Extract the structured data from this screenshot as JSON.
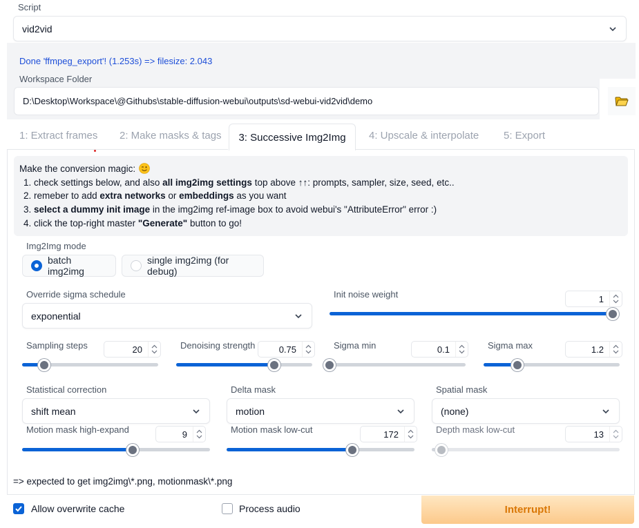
{
  "script": {
    "label": "Script",
    "value": "vid2vid"
  },
  "status_message": "Done 'ffmpeg_export'! (1.253s) => filesize: 2.043",
  "workspace": {
    "label": "Workspace Folder",
    "value": "D:\\Desktop\\Workspace\\@Githubs\\stable-diffusion-webui\\outputs\\sd-webui-vid2vid\\demo"
  },
  "tabs": [
    {
      "label": "1: Extract frames",
      "active": false
    },
    {
      "label": "2: Make masks & tags",
      "active": false
    },
    {
      "label": "3: Successive Img2Img",
      "active": true
    },
    {
      "label": "4: Upscale & interpolate",
      "active": false
    },
    {
      "label": "5: Export",
      "active": false
    }
  ],
  "instructions": {
    "intro": "Make the conversion magic:",
    "step1": {
      "num": "1.",
      "a": "check settings below, and also ",
      "b": "all img2img settings",
      "c": " top above ↑↑: prompts, sampler, size, seed, etc.."
    },
    "step2": {
      "num": "2.",
      "a": "remeber to add ",
      "b": "extra networks",
      "c": " or ",
      "d": "embeddings",
      "e": " as you want"
    },
    "step3": {
      "num": "3.",
      "b": "select a dummy init image",
      "c": " in the img2img ref-image box to avoid webui's \"AttributeError\" error :)"
    },
    "step4": {
      "num": "4.",
      "a": "click the top-right master ",
      "b": "\"Generate\"",
      "c": " button to go!"
    }
  },
  "img2img_mode": {
    "label": "Img2Img mode",
    "options": [
      {
        "label": "batch img2img",
        "selected": true
      },
      {
        "label": "single img2img (for debug)",
        "selected": false
      }
    ]
  },
  "override_sigma": {
    "label": "Override sigma schedule",
    "value": "exponential"
  },
  "init_noise_weight": {
    "label": "Init noise weight",
    "value": "1",
    "fraction": 1.0
  },
  "sampling_steps": {
    "label": "Sampling steps",
    "value": "20",
    "fraction": 0.16
  },
  "denoising_strength": {
    "label": "Denoising strength",
    "value": "0.75",
    "fraction": 0.72
  },
  "sigma_min": {
    "label": "Sigma min",
    "value": "0.1",
    "fraction": 0.0
  },
  "sigma_max": {
    "label": "Sigma max",
    "value": "1.2",
    "fraction": 0.25
  },
  "statistical_correction": {
    "label": "Statistical correction",
    "value": "shift mean"
  },
  "delta_mask": {
    "label": "Delta mask",
    "value": "motion"
  },
  "spatial_mask": {
    "label": "Spatial mask",
    "value": "(none)"
  },
  "motion_highexpand": {
    "label": "Motion mask high-expand",
    "value": "9",
    "fraction": 0.59
  },
  "motion_lowcut": {
    "label": "Motion mask low-cut",
    "value": "172",
    "fraction": 0.67
  },
  "depth_lowcut": {
    "label": "Depth mask low-cut",
    "value": "13",
    "fraction": 0.05
  },
  "expected_output": "=> expected to get img2img\\*.png, motionmask\\*.png",
  "allow_overwrite": {
    "label": "Allow overwrite cache",
    "checked": true
  },
  "process_audio": {
    "label": "Process audio",
    "checked": false
  },
  "interrupt_label": "Interrupt!",
  "colors": {
    "accent": "#0b63d6",
    "interrupt_text": "#d97706",
    "status_text": "#1d4ed8"
  }
}
